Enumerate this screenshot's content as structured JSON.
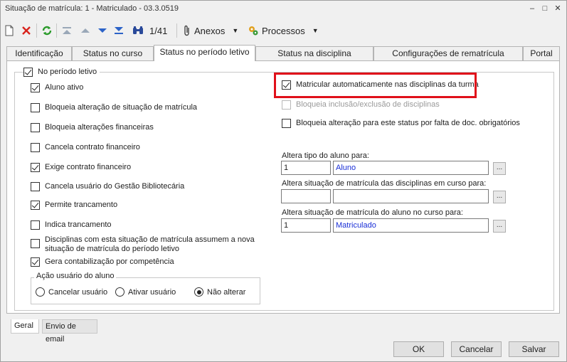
{
  "window": {
    "title": "Situação de matrícula: 1 - Matriculado - 03.3.0519",
    "min_symbol": "–",
    "max_symbol": "□",
    "close_symbol": "✕"
  },
  "toolbar": {
    "counter": "1/41",
    "anexos_label": "Anexos",
    "processos_label": "Processos",
    "icons": [
      "new-document-icon",
      "delete-icon",
      "refresh-icon",
      "first-record-icon",
      "previous-record-icon",
      "next-record-icon",
      "last-record-icon",
      "find-icon",
      "paperclip-icon",
      "processes-icon"
    ]
  },
  "tabs": [
    "Identificação",
    "Status no curso",
    "Status no período letivo",
    "Status na disciplina",
    "Configurações de rematrícula",
    "Portal"
  ],
  "group_title": "No período letivo",
  "left_checks": [
    {
      "label": "Aluno ativo",
      "checked": true
    },
    {
      "label": "Bloqueia alteração de situação de matrícula",
      "checked": false
    },
    {
      "label": "Bloqueia alterações financeiras",
      "checked": false
    },
    {
      "label": "Cancela contrato financeiro",
      "checked": false
    },
    {
      "label": "Exige contrato financeiro",
      "checked": true
    },
    {
      "label": "Cancela usuário do Gestão Bibliotecária",
      "checked": false
    },
    {
      "label": "Permite trancamento",
      "checked": true
    },
    {
      "label": "Indica trancamento",
      "checked": false
    },
    {
      "label": "Disciplinas com esta situação de matrícula assumem a nova",
      "label2": "situação de matrícula do período letivo",
      "checked": false
    },
    {
      "label": "Gera contabilização por competência",
      "checked": true
    }
  ],
  "acao_usuario": {
    "title": "Ação usuário do aluno",
    "options": [
      "Cancelar usuário",
      "Ativar usuário",
      "Não alterar"
    ],
    "selected": "Não alterar"
  },
  "right_checks": [
    {
      "label": "Matricular automaticamente nas disciplinas da turma",
      "checked": true
    },
    {
      "label": "Bloqueia inclusão/exclusão de disciplinas",
      "checked": false,
      "disabled": true
    },
    {
      "label": "Bloqueia alteração para este status por falta de doc. obrigatórios",
      "checked": false
    }
  ],
  "fields": [
    {
      "label": "Altera tipo do aluno para:",
      "code": "1",
      "description": "Aluno"
    },
    {
      "label": "Altera situação de matrícula das disciplinas em curso para:",
      "code": "",
      "description": ""
    },
    {
      "label": "Altera situação de matrícula do aluno no curso para:",
      "code": "1",
      "description": "Matriculado"
    }
  ],
  "ellipsis_label": "...",
  "bottom_tabs": [
    "Geral",
    "Envio de email"
  ],
  "buttons": {
    "ok": "OK",
    "cancel": "Cancelar",
    "save": "Salvar"
  },
  "colors": {
    "highlight": "#e0101a",
    "link_text": "#1a2fd6"
  }
}
